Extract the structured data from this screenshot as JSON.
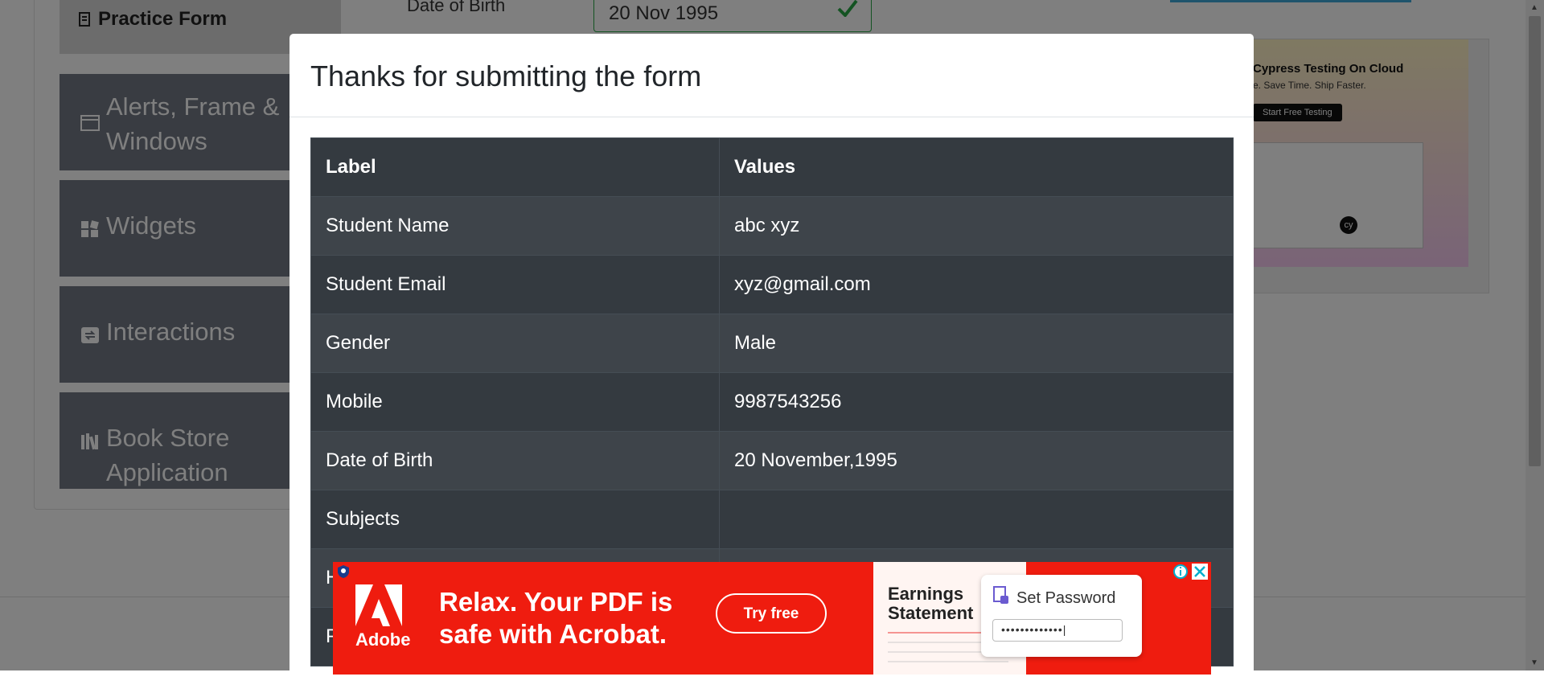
{
  "sidebar": {
    "active_item": "Practice Form",
    "groups": [
      {
        "label": "Alerts, Frame & Windows",
        "icon": "window-icon"
      },
      {
        "label": "Widgets",
        "icon": "widgets-icon"
      },
      {
        "label": "Interactions",
        "icon": "interactions-icon"
      },
      {
        "label": "Book Store Application",
        "icon": "books-icon"
      }
    ]
  },
  "form": {
    "dob_label": "Date of Birth",
    "dob_value": "20 Nov 1995"
  },
  "side_ad": {
    "title": "Cypress Testing On Cloud",
    "subtitle": "e. Save Time. Ship Faster.",
    "button": "Start Free Testing",
    "logo_text": "cy"
  },
  "modal": {
    "title": "Thanks for submitting the form",
    "columns": [
      "Label",
      "Values"
    ],
    "rows": [
      {
        "label": "Student Name",
        "value": "abc xyz"
      },
      {
        "label": "Student Email",
        "value": "xyz@gmail.com"
      },
      {
        "label": "Gender",
        "value": "Male"
      },
      {
        "label": "Mobile",
        "value": "9987543256"
      },
      {
        "label": "Date of Birth",
        "value": "20 November,1995"
      },
      {
        "label": "Subjects",
        "value": ""
      },
      {
        "label": "H",
        "value": ""
      },
      {
        "label": "P",
        "value": ""
      }
    ]
  },
  "bottom_ad": {
    "brand": "Adobe",
    "headline_line1": "Relax. Your PDF is",
    "headline_line2": "safe with Acrobat.",
    "cta": "Try free",
    "doc_title_line1": "Earnings",
    "doc_title_line2": "Statement",
    "password_title": "Set Password",
    "password_value": "•••••••••••••|"
  },
  "colors": {
    "overlay": "#000000",
    "table_dark": "#343a40",
    "table_striped": "#3e444a",
    "valid_green": "#28a745",
    "ad_red": "#ef1c0f"
  }
}
